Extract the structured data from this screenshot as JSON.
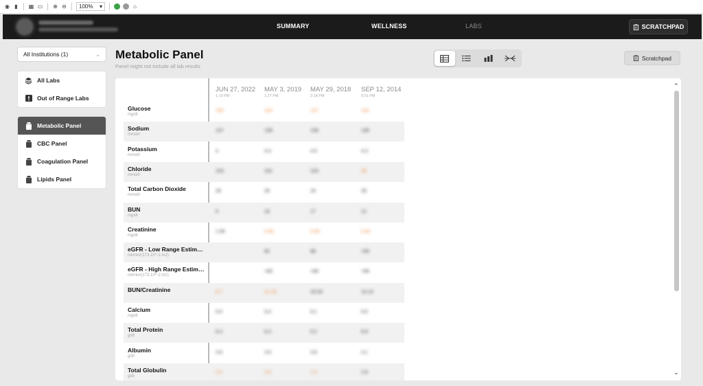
{
  "browser": {
    "zoom": "100%"
  },
  "header": {
    "nav": [
      "SUMMARY",
      "WELLNESS",
      "LABS"
    ],
    "scratchpad": "SCRATCHPAD"
  },
  "sidebar": {
    "institution": "All Institutions (1)",
    "group1": [
      {
        "label": "All Labs",
        "icon": "layers-icon"
      },
      {
        "label": "Out of Range Labs",
        "icon": "alert-icon"
      }
    ],
    "group2": [
      {
        "label": "Metabolic Panel",
        "icon": "flask-icon"
      },
      {
        "label": "CBC Panel",
        "icon": "flask-icon"
      },
      {
        "label": "Coagulation Panel",
        "icon": "flask-icon"
      },
      {
        "label": "Lipids Panel",
        "icon": "flask-icon"
      }
    ]
  },
  "page": {
    "title": "Metabolic Panel",
    "subtitle": "Panel might not include all lab results",
    "scratchpad": "Scratchpad"
  },
  "table": {
    "columns": [
      {
        "date": "JUN 27, 2022",
        "time": "1:19 PM"
      },
      {
        "date": "MAY 3, 2019",
        "time": "1:27 PM"
      },
      {
        "date": "MAY 29, 2018",
        "time": "2:18 PM"
      },
      {
        "date": "SEP 12, 2014",
        "time": "5:51 PM"
      }
    ],
    "rows": [
      {
        "name": "Glucose",
        "unit": "mg/dl",
        "values": [
          {
            "v": "105",
            "hi": true
          },
          {
            "v": "104",
            "hi": true
          },
          {
            "v": "107",
            "hi": true
          },
          {
            "v": "104",
            "hi": true
          }
        ]
      },
      {
        "name": "Sodium",
        "unit": "mmol/l",
        "values": [
          {
            "v": "137",
            "hi": false
          },
          {
            "v": "138",
            "hi": false
          },
          {
            "v": "138",
            "hi": false
          },
          {
            "v": "138",
            "hi": false
          }
        ]
      },
      {
        "name": "Potassium",
        "unit": "mmol/l",
        "values": [
          {
            "v": "4",
            "hi": false
          },
          {
            "v": "4.4",
            "hi": false
          },
          {
            "v": "4.5",
            "hi": false
          },
          {
            "v": "4.3",
            "hi": false
          }
        ]
      },
      {
        "name": "Chloride",
        "unit": "mmol/l",
        "values": [
          {
            "v": "103",
            "hi": false
          },
          {
            "v": "102",
            "hi": false
          },
          {
            "v": "103",
            "hi": false
          },
          {
            "v": "98",
            "hi": true
          }
        ]
      },
      {
        "name": "Total Carbon Dioxide",
        "unit": "mmol/l",
        "values": [
          {
            "v": "28",
            "hi": false
          },
          {
            "v": "28",
            "hi": false
          },
          {
            "v": "24",
            "hi": false
          },
          {
            "v": "28",
            "hi": false
          }
        ]
      },
      {
        "name": "BUN",
        "unit": "mg/dl",
        "values": [
          {
            "v": "9",
            "hi": false
          },
          {
            "v": "18",
            "hi": false
          },
          {
            "v": "17",
            "hi": false
          },
          {
            "v": "12",
            "hi": false
          }
        ]
      },
      {
        "name": "Creatinine",
        "unit": "mg/dl",
        "values": [
          {
            "v": "1.06",
            "hi": false
          },
          {
            "v": "0.85",
            "hi": true
          },
          {
            "v": "0.58",
            "hi": true
          },
          {
            "v": "0.82",
            "hi": true
          }
        ]
      },
      {
        "name": "eGFR - Low Range Estimate",
        "unit": "ml/min/(173.10^-2.m2)",
        "values": [
          {
            "v": "",
            "hi": false
          },
          {
            "v": "60",
            "hi": false
          },
          {
            "v": "88",
            "hi": false
          },
          {
            "v": ">90",
            "hi": false
          }
        ]
      },
      {
        "name": "eGFR - High Range Estimate",
        "unit": "ml/min/(173.10^-2.m2)",
        "values": [
          {
            "v": "",
            "hi": false
          },
          {
            "v": ">90",
            "hi": false
          },
          {
            "v": ">90",
            "hi": false
          },
          {
            "v": ">90",
            "hi": false
          }
        ]
      },
      {
        "name": "BUN/Creatinine",
        "unit": "",
        "values": [
          {
            "v": "8.7",
            "hi": true
          },
          {
            "v": "21.18",
            "hi": true
          },
          {
            "v": "18.33",
            "hi": false
          },
          {
            "v": "14.13",
            "hi": false
          }
        ]
      },
      {
        "name": "Calcium",
        "unit": "mg/dl",
        "values": [
          {
            "v": "9.5",
            "hi": false
          },
          {
            "v": "9.3",
            "hi": false
          },
          {
            "v": "9.1",
            "hi": false
          },
          {
            "v": "9.5",
            "hi": false
          }
        ]
      },
      {
        "name": "Total Protein",
        "unit": "g/dl",
        "values": [
          {
            "v": "6.3",
            "hi": false
          },
          {
            "v": "6.4",
            "hi": false
          },
          {
            "v": "6.2",
            "hi": false
          },
          {
            "v": "6.8",
            "hi": false
          }
        ]
      },
      {
        "name": "Albumin",
        "unit": "g/dl",
        "values": [
          {
            "v": "3.8",
            "hi": false
          },
          {
            "v": "3.9",
            "hi": false
          },
          {
            "v": "3.8",
            "hi": false
          },
          {
            "v": "4.1",
            "hi": false
          }
        ]
      },
      {
        "name": "Total Globulin",
        "unit": "g/dl",
        "values": [
          {
            "v": "2.5",
            "hi": true
          },
          {
            "v": "2.5",
            "hi": true
          },
          {
            "v": "2.4",
            "hi": true
          },
          {
            "v": "2.8",
            "hi": false
          }
        ]
      }
    ]
  },
  "colors": {
    "accent_high": "#f08a3c",
    "header_bg": "#1b1b1b",
    "active_item": "#555555"
  }
}
